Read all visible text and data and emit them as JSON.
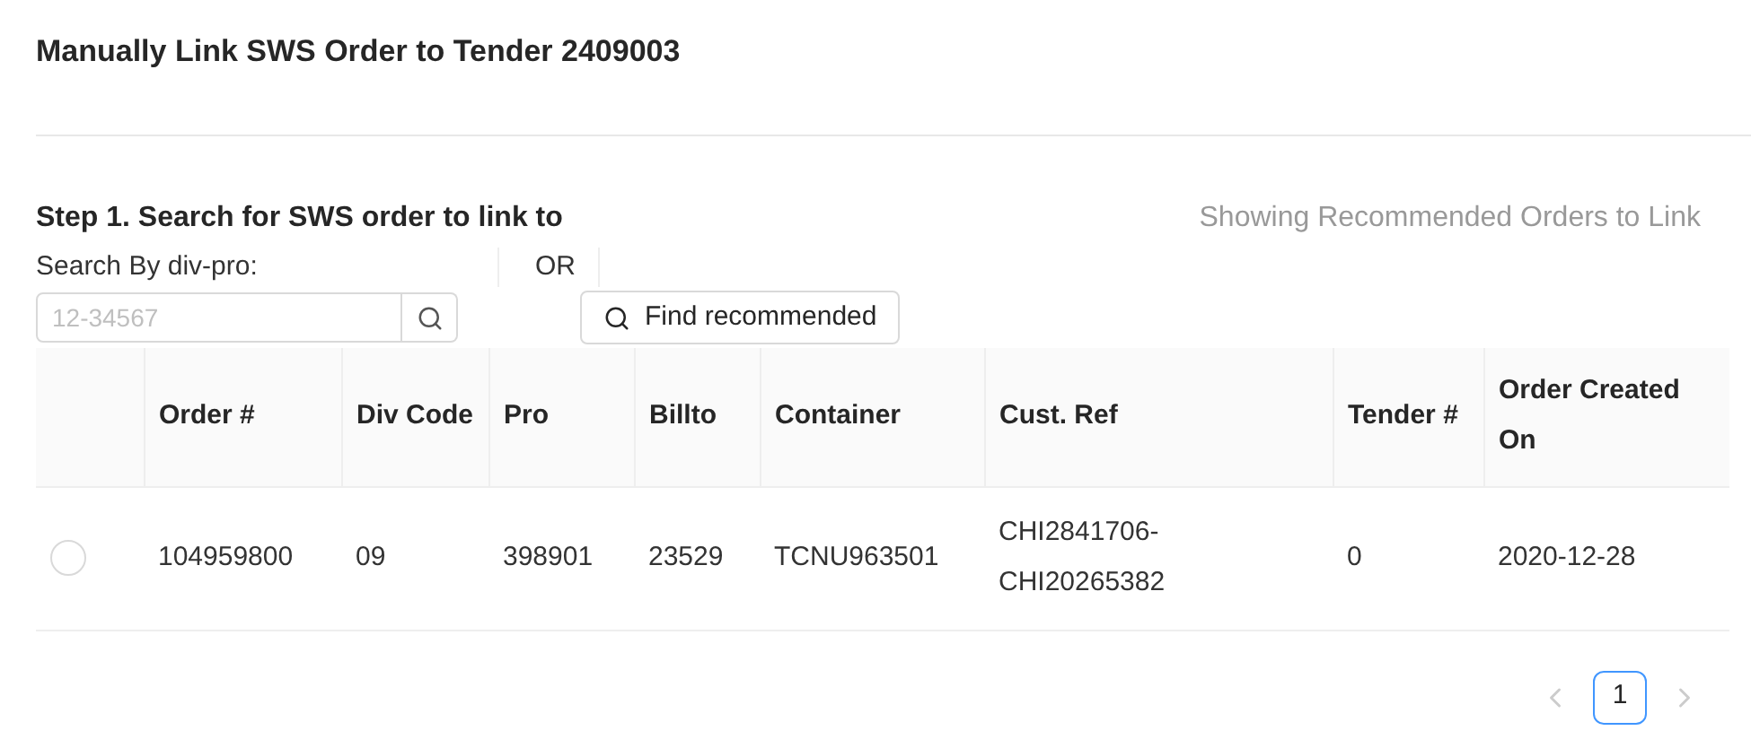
{
  "title": "Manually Link SWS Order to Tender 2409003",
  "step": {
    "heading": "Step 1. Search for SWS order to link to",
    "status": "Showing Recommended Orders to Link",
    "search_label": "Search By div-pro:",
    "search": {
      "placeholder": "12-34567"
    },
    "or": "OR",
    "find_button": "Find recommended"
  },
  "table": {
    "columns": [
      {
        "label": "Order #"
      },
      {
        "label": "Div Code"
      },
      {
        "label": "Pro"
      },
      {
        "label": "Billto"
      },
      {
        "label": "Container"
      },
      {
        "label": "Cust. Ref"
      },
      {
        "label": "Tender #"
      },
      {
        "label": "Order Created On"
      }
    ],
    "rows": [
      {
        "selected": false,
        "cells": [
          "104959800",
          "09",
          "398901",
          "23529",
          "TCNU963501",
          "CHI2841706-CHI20265382",
          "0",
          "2020-12-28"
        ]
      }
    ]
  },
  "pagination": {
    "prev_disabled": true,
    "next_disabled": true,
    "pages": [
      {
        "label": "1",
        "selected": true
      }
    ]
  }
}
